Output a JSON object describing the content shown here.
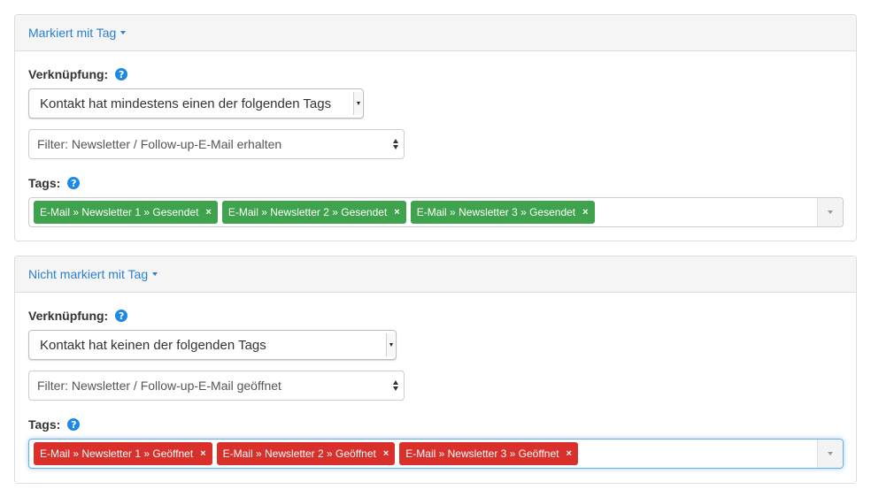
{
  "panels": [
    {
      "heading": "Markiert mit Tag",
      "link_label": "Verknüpfung:",
      "link_value": "Kontakt hat mindestens einen der folgenden Tags",
      "filter_value": "Filter: Newsletter / Follow-up-E-Mail erhalten",
      "tags_label": "Tags:",
      "tags": [
        "E-Mail » Newsletter 1 » Gesendet",
        "E-Mail » Newsletter 2 » Gesendet",
        "E-Mail » Newsletter 3 » Gesendet"
      ],
      "tag_color": "#3fa34d"
    },
    {
      "heading": "Nicht markiert mit Tag",
      "link_label": "Verknüpfung:",
      "link_value": "Kontakt hat keinen der folgenden Tags",
      "filter_value": "Filter: Newsletter / Follow-up-E-Mail geöffnet",
      "tags_label": "Tags:",
      "tags": [
        "E-Mail » Newsletter 1 » Geöffnet",
        "E-Mail » Newsletter 2 » Geöffnet",
        "E-Mail » Newsletter 3 » Geöffnet"
      ],
      "tag_color": "#d9302c"
    }
  ],
  "icons": {
    "help": "question-circle-icon",
    "remove": "×"
  },
  "colors": {
    "link": "#2a7fd1",
    "help_icon": "#1e88e5",
    "focus_border": "#66afe9"
  }
}
